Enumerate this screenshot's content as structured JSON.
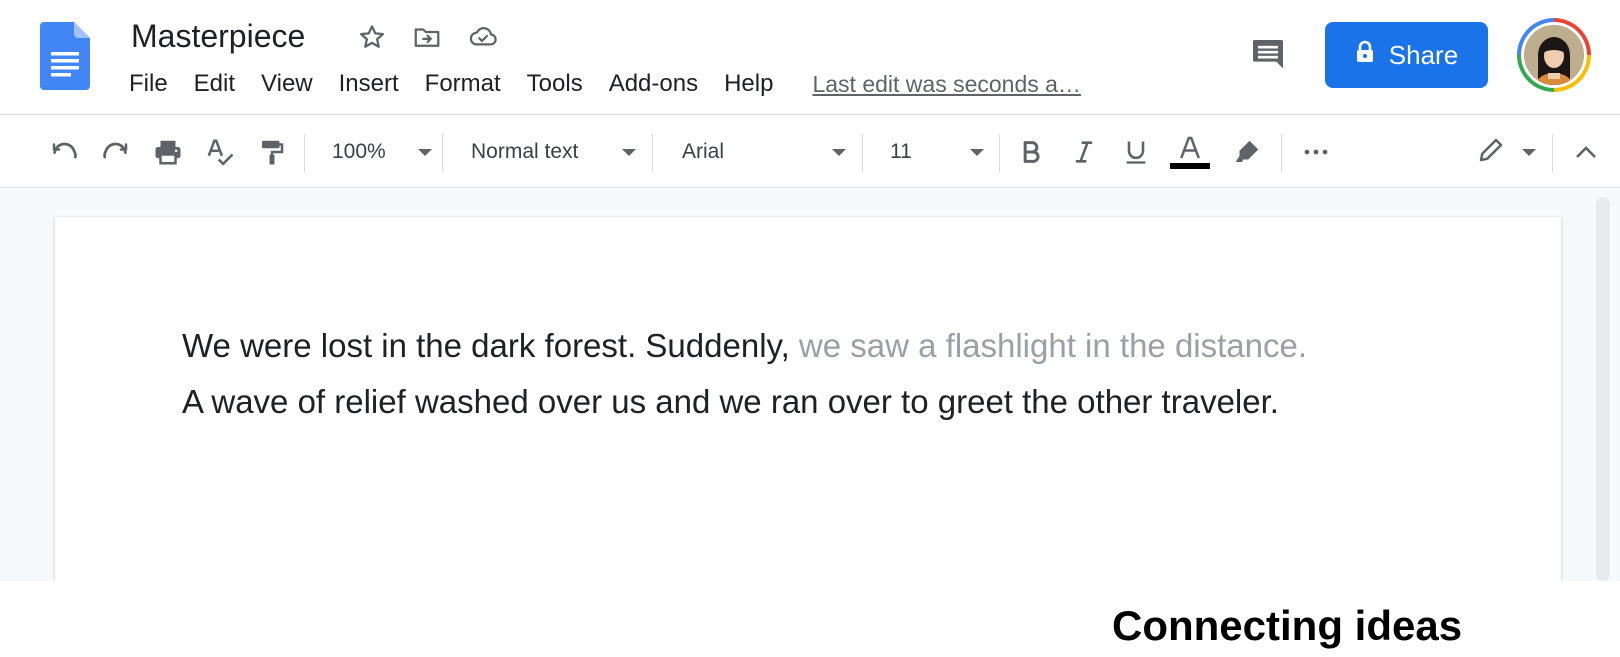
{
  "app": {
    "doc_title": "Masterpiece",
    "logo_icon": "google-docs-logo",
    "title_icons": [
      "star-icon",
      "move-to-folder-icon",
      "cloud-saved-icon"
    ]
  },
  "menu": {
    "items": [
      {
        "label": "File"
      },
      {
        "label": "Edit"
      },
      {
        "label": "View"
      },
      {
        "label": "Insert"
      },
      {
        "label": "Format"
      },
      {
        "label": "Tools"
      },
      {
        "label": "Add-ons"
      },
      {
        "label": "Help"
      }
    ],
    "last_edit": "Last edit was seconds a…"
  },
  "header_actions": {
    "comment_icon": "comment-icon",
    "share_label": "Share",
    "share_icon": "lock-icon",
    "avatar_icon": "account-avatar"
  },
  "toolbar": {
    "zoom": "100%",
    "style": "Normal text",
    "font": "Arial",
    "font_size": "11",
    "text_color": "#000000",
    "icons": [
      "undo-icon",
      "redo-icon",
      "print-icon",
      "spellcheck-icon",
      "paint-format-icon",
      "bold-icon",
      "italic-icon",
      "underline-icon",
      "text-color-icon",
      "highlight-icon",
      "more-icon",
      "editing-mode-icon",
      "collapse-icon"
    ]
  },
  "document": {
    "line1_typed": "We were lost in the dark forest. Suddenly,",
    "line1_suggestion": " we saw a flashlight in the distance.",
    "line2": "A wave of relief washed over us and we ran over to greet the other traveler."
  },
  "caption": "Connecting ideas",
  "colors": {
    "accent": "#1a73e8",
    "suggestion_text": "#9aa0a6",
    "docs_blue": "#4285f4"
  }
}
